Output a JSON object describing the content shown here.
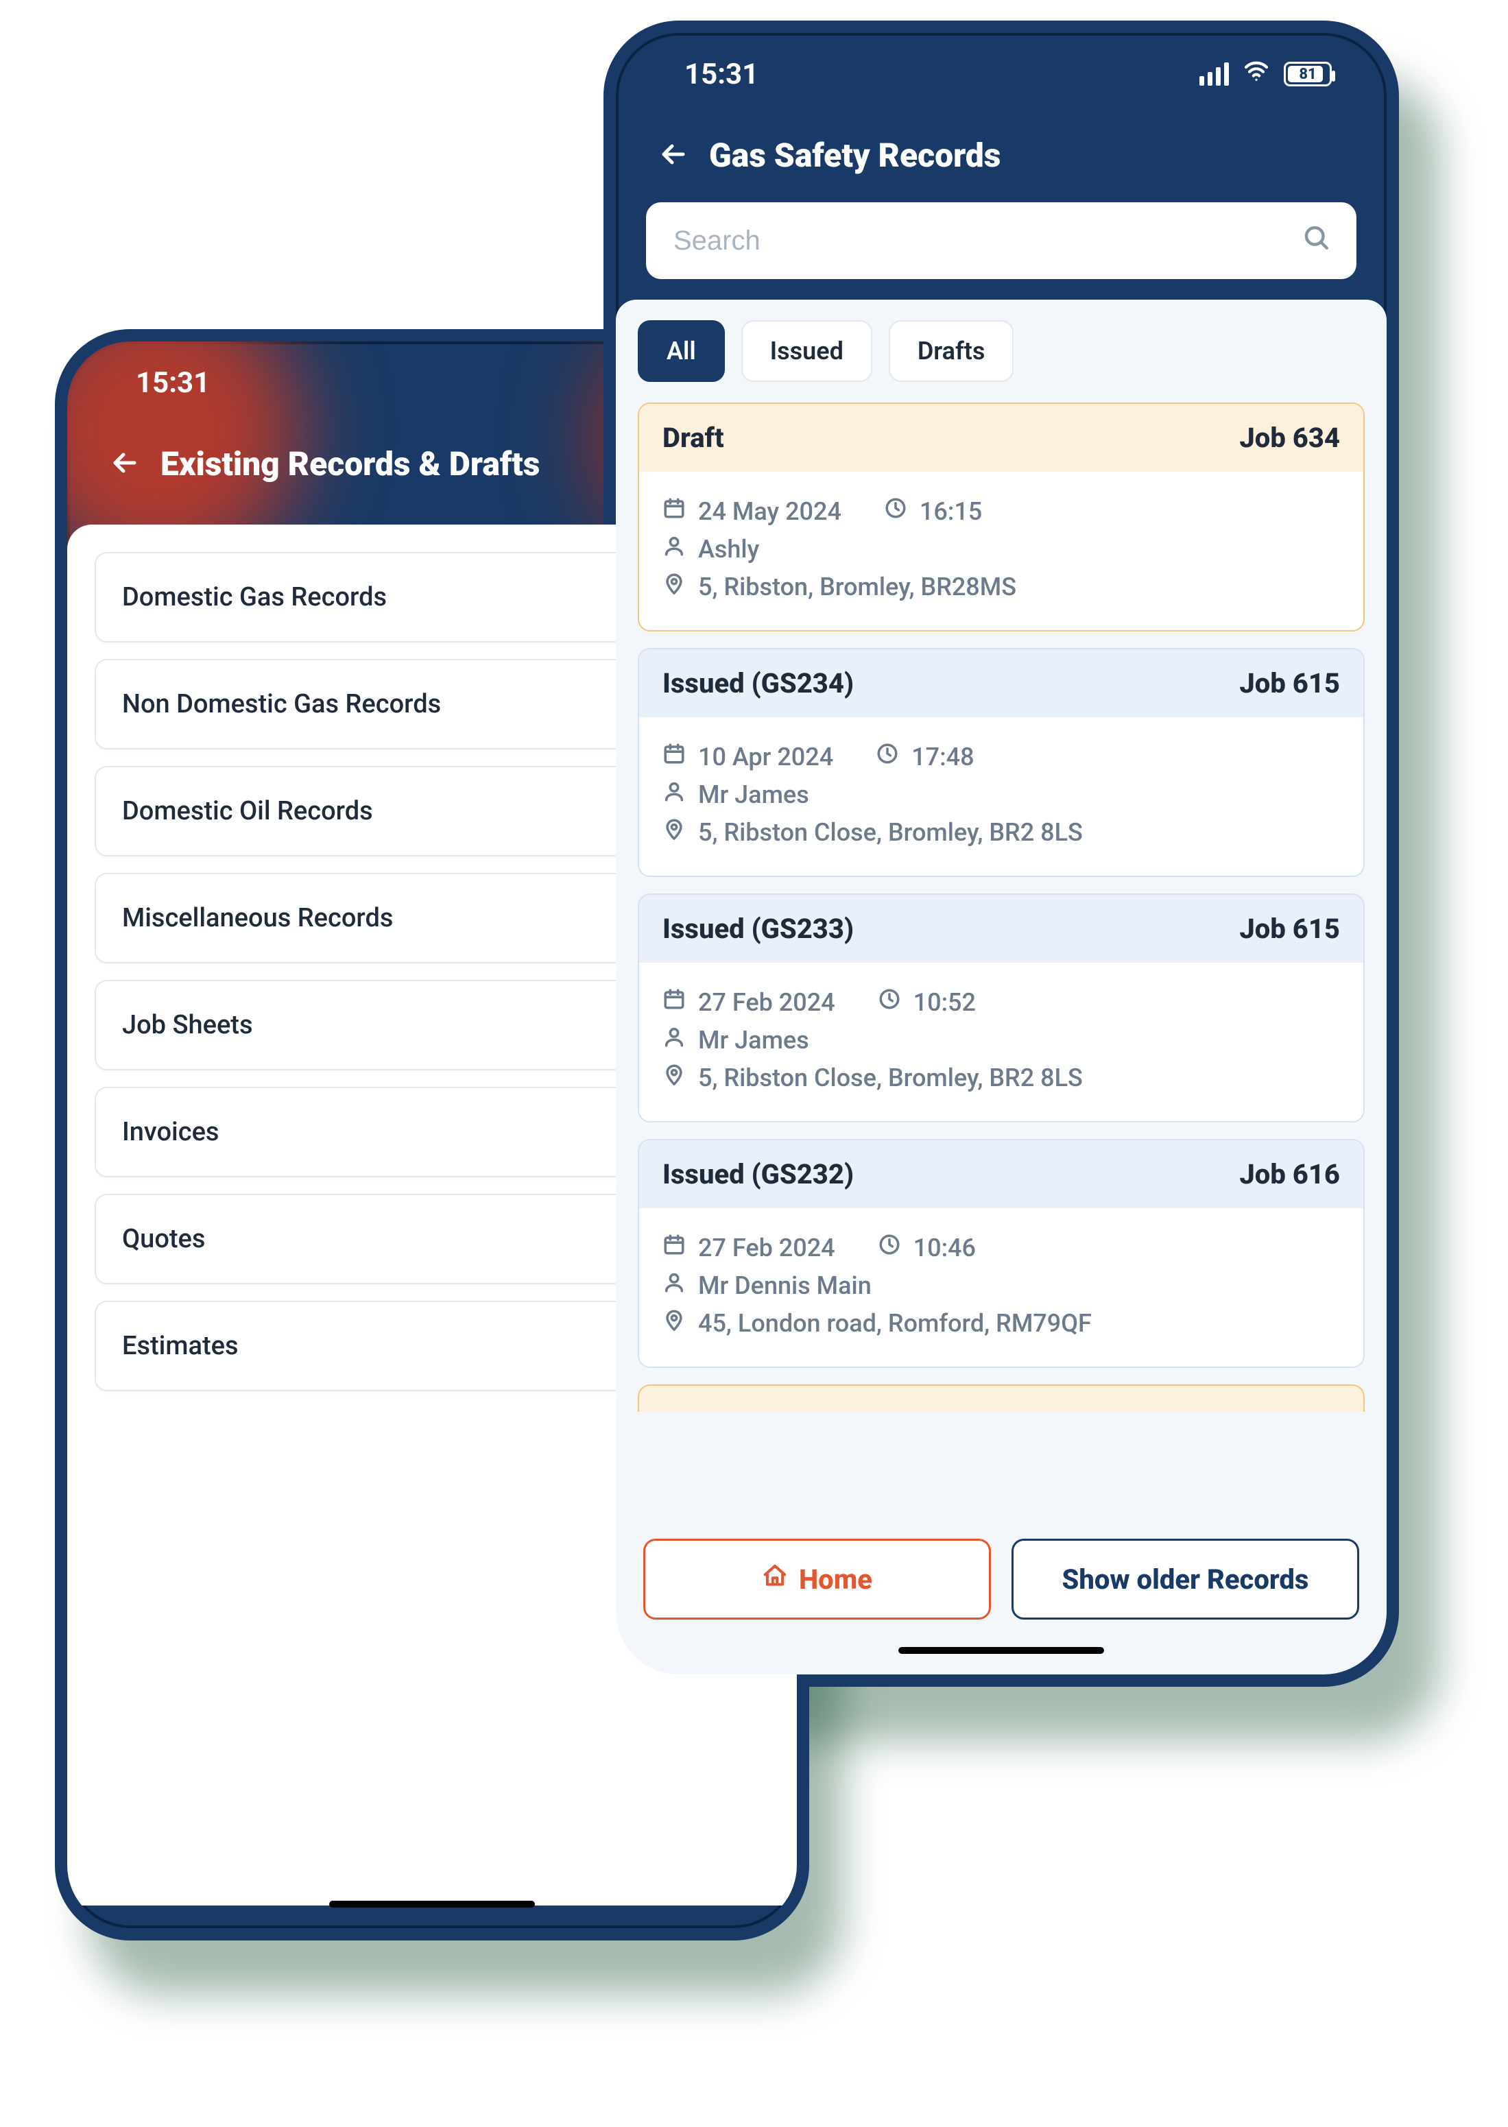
{
  "status": {
    "time": "15:31",
    "battery": "81"
  },
  "phone1": {
    "title": "Existing Records & Drafts",
    "items": [
      "Domestic Gas Records",
      "Non Domestic Gas Records",
      "Domestic Oil Records",
      "Miscellaneous Records",
      "Job Sheets",
      "Invoices",
      "Quotes",
      "Estimates"
    ]
  },
  "phone2": {
    "title": "Gas Safety Records",
    "search_placeholder": "Search",
    "tabs": {
      "all": "All",
      "issued": "Issued",
      "drafts": "Drafts"
    },
    "records": [
      {
        "type": "draft",
        "status": "Draft",
        "job": "Job 634",
        "date": "24 May 2024",
        "time": "16:15",
        "person": "Ashly",
        "address": "5, Ribston, Bromley, BR28MS"
      },
      {
        "type": "issued",
        "status": "Issued (GS234)",
        "job": "Job 615",
        "date": "10 Apr 2024",
        "time": "17:48",
        "person": "Mr  James",
        "address": "5, Ribston Close, Bromley, BR2 8LS"
      },
      {
        "type": "issued",
        "status": "Issued (GS233)",
        "job": "Job 615",
        "date": "27 Feb 2024",
        "time": "10:52",
        "person": "Mr  James",
        "address": "5, Ribston Close, Bromley, BR2 8LS"
      },
      {
        "type": "issued",
        "status": "Issued (GS232)",
        "job": "Job 616",
        "date": "27 Feb 2024",
        "time": "10:46",
        "person": "Mr Dennis Main",
        "address": "45, London road, Romford, RM79QF"
      }
    ],
    "buttons": {
      "home": "Home",
      "older": "Show older Records"
    }
  }
}
